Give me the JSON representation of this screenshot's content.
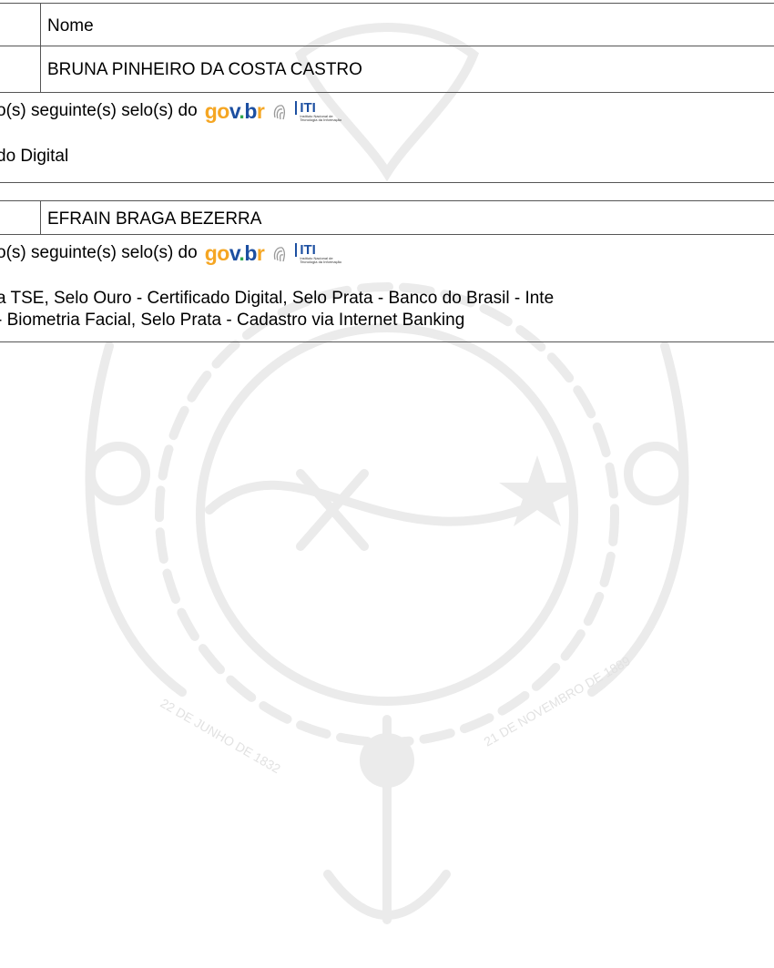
{
  "signer1": {
    "header_label": "Nome",
    "name": "BRUNA PINHEIRO DA COSTA CASTRO",
    "seal_intro": "o(s) seguinte(s) selo(s) do",
    "seals": "do Digital"
  },
  "signer2": {
    "name": "EFRAIN BRAGA BEZERRA",
    "seal_intro": "o(s) seguinte(s) selo(s) do",
    "seals_line1": "a TSE, Selo Ouro - Certificado Digital, Selo Prata - Banco do Brasil - Inte",
    "seals_line2": "- Biometria Facial, Selo Prata - Cadastro via Internet Banking"
  },
  "logos": {
    "govbr_g": "g",
    "govbr_o": "o",
    "govbr_v": "v",
    "govbr_dot": ".",
    "govbr_b": "b",
    "govbr_r": "r",
    "iti_mark": "ITI",
    "iti_sub_1": "Instituto Nacional de",
    "iti_sub_2": "Tecnologia da Informação"
  },
  "watermark": {
    "left_ribbon": "22 DE JUNHO DE 1832",
    "right_ribbon": "21 DE NOVEMBRO DE 1889"
  },
  "colors": {
    "govbr_yellow": "#f5a623",
    "govbr_blue": "#1c4fa1",
    "govbr_green": "#2fa84f",
    "watermark": "#ececec"
  }
}
